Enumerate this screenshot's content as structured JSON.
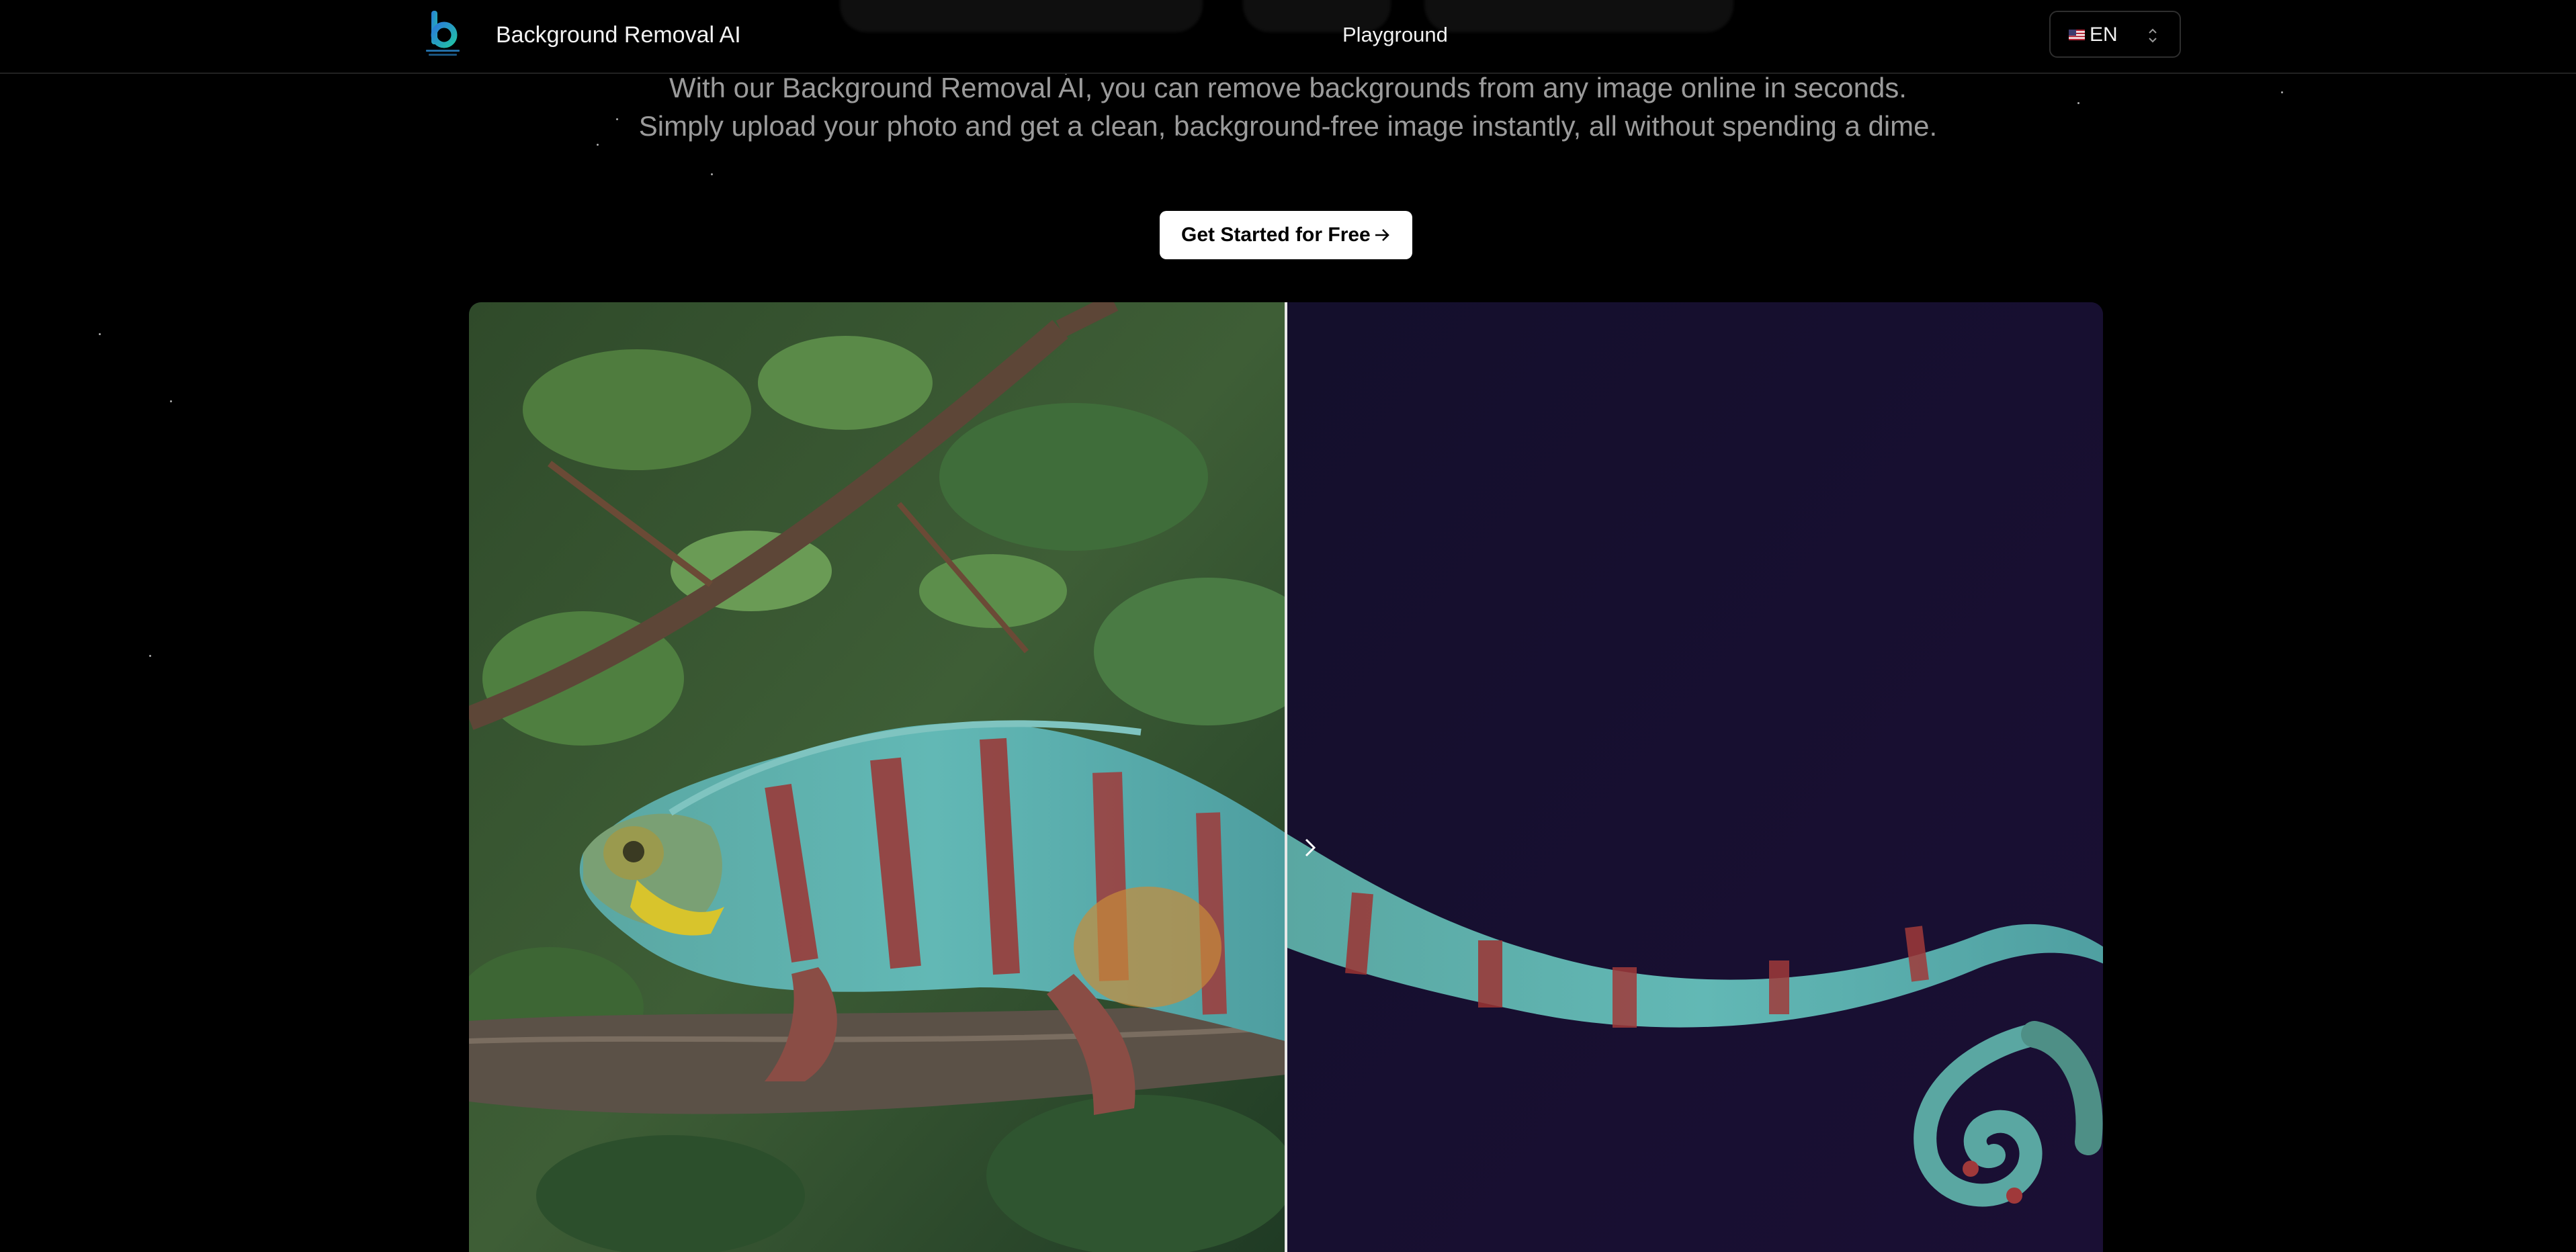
{
  "navbar": {
    "brand": "Background Removal AI",
    "links": [
      "Playground"
    ],
    "language": {
      "flag": "flag-us-icon",
      "code": "EN"
    }
  },
  "hero": {
    "subtitle_lines": [
      "With our Background Removal AI, you can remove backgrounds from any image online in seconds.",
      "Simply upload your photo and get a clean, background-free image instantly, all without spending a dime."
    ],
    "cta_label": "Get Started for Free"
  },
  "comparison": {
    "left_label": "",
    "right_label": "",
    "slider_position": 0.5
  },
  "colors": {
    "background": "#000000",
    "accent": "#ffffff",
    "subtitle": "#9b9b9b",
    "removed_background": "#140f2c"
  }
}
